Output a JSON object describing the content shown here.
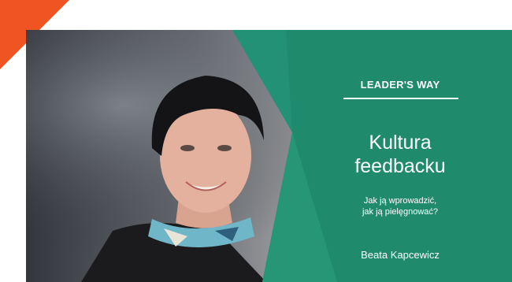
{
  "banner": {
    "series_label": "LEADER'S WAY",
    "title_line1": "Kultura",
    "title_line2": "feedbacku",
    "subtitle_line1": "Jak ją wprowadzić,",
    "subtitle_line2": "jak ją pielęgnować?",
    "author": "Beata Kapcewicz"
  },
  "colors": {
    "accent_orange": "#f05423",
    "panel_green": "#1f8a6c",
    "panel_green_light": "#2ba07f",
    "text_white": "#ffffff"
  },
  "icons": {
    "corner": "orange-corner-triangle",
    "photo": "portrait-photo"
  }
}
